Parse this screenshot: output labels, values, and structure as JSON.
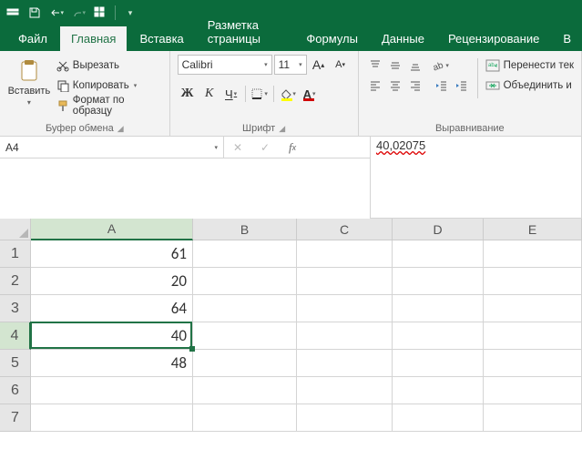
{
  "qat": {
    "save": "save-icon",
    "undo": "undo-icon",
    "redo": "redo-icon",
    "touch": "touch-icon"
  },
  "tabs": {
    "file": "Файл",
    "home": "Главная",
    "insert": "Вставка",
    "layout": "Разметка страницы",
    "formulas": "Формулы",
    "data": "Данные",
    "review": "Рецензирование",
    "view_partial": "В"
  },
  "ribbon": {
    "clipboard": {
      "paste": "Вставить",
      "cut": "Вырезать",
      "copy": "Копировать",
      "format_painter": "Формат по образцу",
      "label": "Буфер обмена"
    },
    "font": {
      "name": "Calibri",
      "size": "11",
      "increase": "A",
      "decrease": "A",
      "bold": "Ж",
      "italic": "К",
      "underline": "Ч",
      "fill_color": "#ffff00",
      "font_color": "#d00000",
      "label": "Шрифт"
    },
    "align": {
      "wrap": "Перенести тек",
      "merge": "Объединить и",
      "label": "Выравнивание"
    }
  },
  "namebox": "A4",
  "formula_value": "40,02075",
  "columns": [
    "A",
    "B",
    "C",
    "D",
    "E"
  ],
  "rows": [
    "1",
    "2",
    "3",
    "4",
    "5",
    "6",
    "7"
  ],
  "cells": {
    "A1": "61",
    "A2": "20",
    "A3": "64",
    "A4": "40",
    "A5": "48"
  },
  "selected": {
    "row": 4,
    "col": "A"
  }
}
